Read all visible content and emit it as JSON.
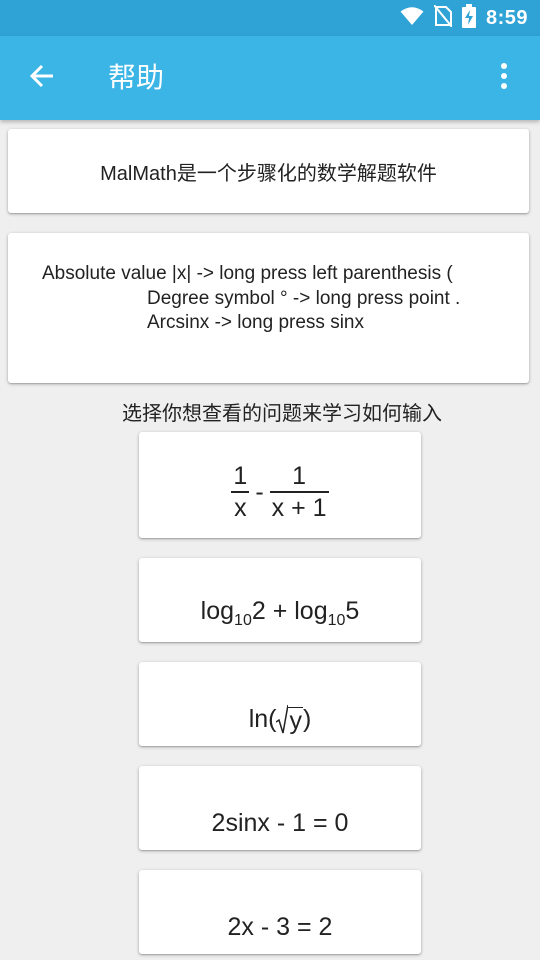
{
  "status_bar": {
    "time": "8:59",
    "icons": [
      "wifi-icon",
      "no-sim-icon",
      "battery-charging-icon"
    ]
  },
  "app_bar": {
    "title": "帮助",
    "back_icon": "arrow-left-icon",
    "more_icon": "more-vertical-icon"
  },
  "intro": {
    "text": "MalMath是一个步骤化的数学解题软件"
  },
  "hints": {
    "line1": "Absolute value |x| -> long press left parenthesis (",
    "line2": "Degree symbol ° -> long press point .",
    "line3": "Arcsinx -> long press sinx"
  },
  "section": {
    "label": "选择你想查看的问题来学习如何输入"
  },
  "problems": {
    "p1": {
      "frac1_num": "1",
      "frac1_den": "x",
      "op": "-",
      "frac2_num": "1",
      "frac2_den": "x + 1"
    },
    "p2": {
      "log1": "log",
      "base1": "10",
      "arg1": "2 + ",
      "log2": "log",
      "base2": "10",
      "arg2": "5"
    },
    "p3": {
      "fn": "ln(",
      "radicand": "y",
      "close": ")"
    },
    "p4": {
      "expr": "2sinx - 1 = 0"
    },
    "p5": {
      "expr": "2x - 3 = 2"
    }
  },
  "colors": {
    "status_bar": "#2fa3d6",
    "app_bar": "#3ab5e6",
    "background": "#efefef"
  }
}
